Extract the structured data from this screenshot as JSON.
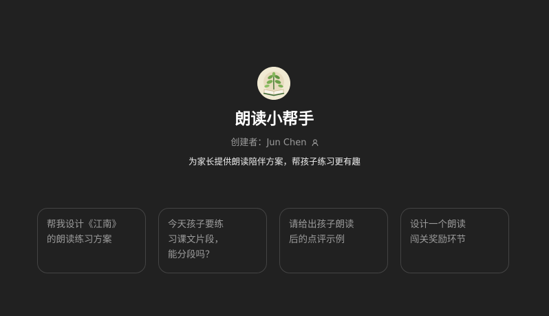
{
  "assistant": {
    "avatar_icon": "book-with-plant-icon",
    "title": "朗读小帮手",
    "creator_label": "创建者：",
    "creator_name": "Jun Chen",
    "creator_icon": "person-icon",
    "description": "为家长提供朗读陪伴方案，帮孩子练习更有趣"
  },
  "starters": [
    {
      "lines": [
        "帮我设计《江南》",
        "的朗读练习方案"
      ]
    },
    {
      "lines": [
        "今天孩子要练",
        "习课文片段，",
        "能分段吗？"
      ]
    },
    {
      "lines": [
        "请给出孩子朗读",
        "后的点评示例"
      ]
    },
    {
      "lines": [
        "设计一个朗读",
        "闯关奖励环节"
      ]
    }
  ],
  "colors": {
    "background": "#212121",
    "card_border": "#444444",
    "muted_text": "#9b9b9b",
    "title_text": "#ffffff"
  }
}
